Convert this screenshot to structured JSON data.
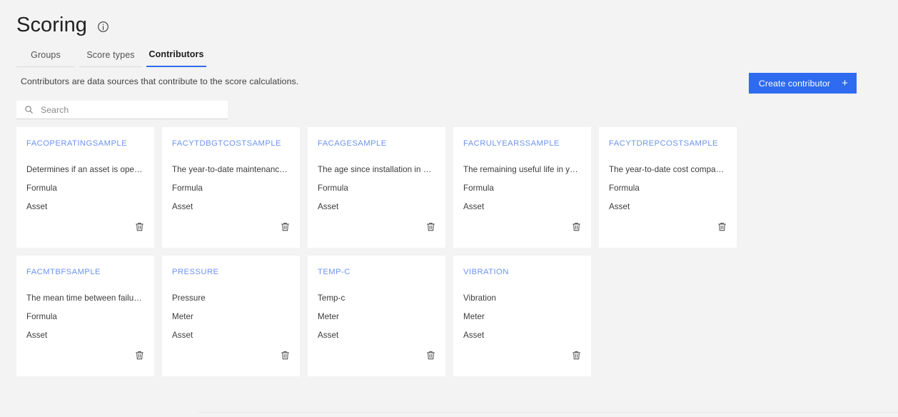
{
  "header": {
    "title": "Scoring",
    "info_icon": "info-icon"
  },
  "tabs": [
    {
      "label": "Groups",
      "active": false
    },
    {
      "label": "Score types",
      "active": false
    },
    {
      "label": "Contributors",
      "active": true
    }
  ],
  "description": "Contributors are data sources that contribute to the score calculations.",
  "create_button": {
    "label": "Create contributor",
    "icon": "plus-icon",
    "color": "#2f6bf0"
  },
  "search": {
    "placeholder": "Search",
    "value": "",
    "icon": "search-icon"
  },
  "colors": {
    "accent": "#2f6bf0",
    "card_title": "#6d94ef",
    "page_bg": "#f3f3f3",
    "card_bg": "#ffffff"
  },
  "cards": [
    {
      "title": "FACOPERATINGSAMPLE",
      "description": "Determines if an asset is operating.",
      "meta1": "Formula",
      "meta2": "Asset",
      "delete_icon": "trash-icon"
    },
    {
      "title": "FACYTDBGTCOSTSAMPLE",
      "description": "The year-to-date maintenance cos...",
      "meta1": "Formula",
      "meta2": "Asset",
      "delete_icon": "trash-icon"
    },
    {
      "title": "FACAGESAMPLE",
      "description": "The age since installation in years.",
      "meta1": "Formula",
      "meta2": "Asset",
      "delete_icon": "trash-icon"
    },
    {
      "title": "FACRULYEARSSAMPLE",
      "description": "The remaining useful life in years.",
      "meta1": "Formula",
      "meta2": "Asset",
      "delete_icon": "trash-icon"
    },
    {
      "title": "FACYTDREPCOSTSAMPLE",
      "description": "The year-to-date cost compared w...",
      "meta1": "Formula",
      "meta2": "Asset",
      "delete_icon": "trash-icon"
    },
    {
      "title": "FACMTBFSAMPLE",
      "description": "The mean time between failures in...",
      "meta1": "Formula",
      "meta2": "Asset",
      "delete_icon": "trash-icon"
    },
    {
      "title": "PRESSURE",
      "description": "Pressure",
      "meta1": "Meter",
      "meta2": "Asset",
      "delete_icon": "trash-icon"
    },
    {
      "title": "TEMP-C",
      "description": "Temp-c",
      "meta1": "Meter",
      "meta2": "Asset",
      "delete_icon": "trash-icon"
    },
    {
      "title": "VIBRATION",
      "description": "Vibration",
      "meta1": "Meter",
      "meta2": "Asset",
      "delete_icon": "trash-icon"
    }
  ]
}
